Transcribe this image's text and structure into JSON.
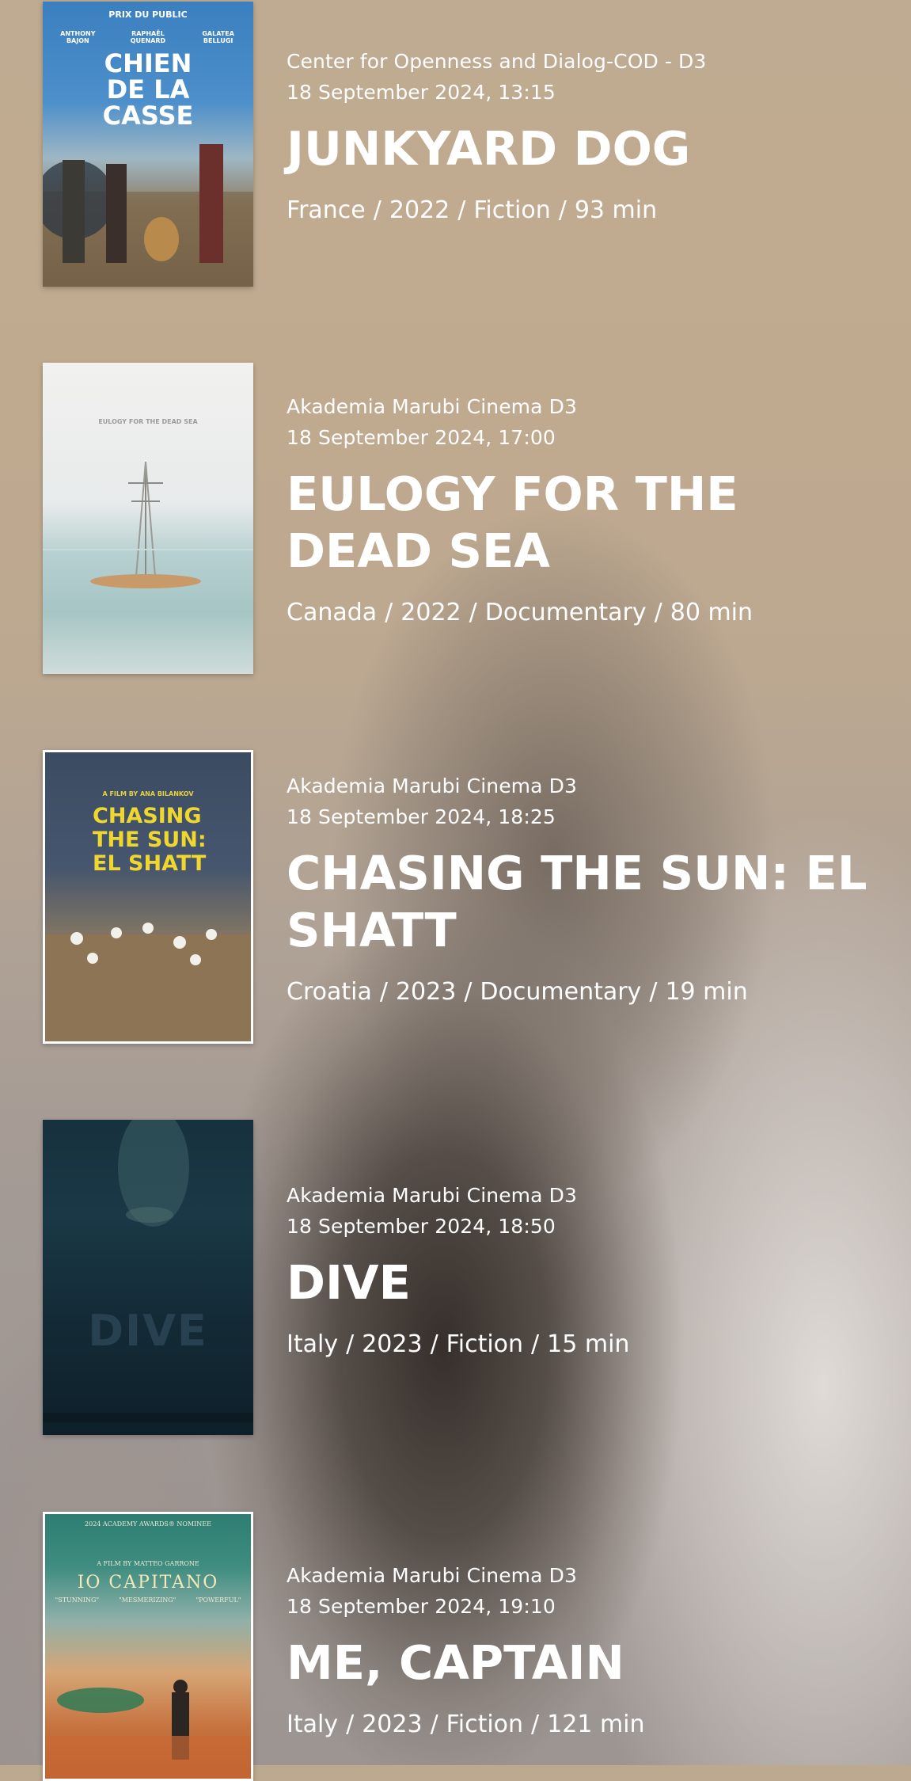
{
  "films": [
    {
      "venue": "Center for Openness and Dialog-COD - D3",
      "datetime": "18 September 2024, 13:15",
      "title": "JUNKYARD DOG",
      "country": "France",
      "year": "2022",
      "genre": "Fiction",
      "duration": "93 min",
      "poster": {
        "badge": "PRIX DU PUBLIC",
        "names": [
          "ANTHONY BAJON",
          "RAPHAËL QUENARD",
          "GALATEA BELLUGI"
        ],
        "title_lines": [
          "CHIEN",
          "DE LA",
          "CASSE"
        ]
      }
    },
    {
      "venue": "Akademia Marubi Cinema D3",
      "datetime": "18 September 2024, 17:00",
      "title": "EULOGY FOR THE DEAD SEA",
      "country": "Canada",
      "year": "2022",
      "genre": "Documentary",
      "duration": "80 min",
      "poster": {
        "title_lines": [
          "EULOGY FOR THE DEAD SEA"
        ]
      }
    },
    {
      "venue": "Akademia Marubi Cinema D3",
      "datetime": "18 September 2024, 18:25",
      "title": "CHASING THE SUN: EL SHATT",
      "country": "Croatia",
      "year": "2023",
      "genre": "Documentary",
      "duration": "19 min",
      "poster": {
        "tagline": "A FILM BY ANA BILANKOV",
        "title_lines": [
          "CHASING",
          "THE SUN:",
          "EL SHATT"
        ]
      }
    },
    {
      "venue": "Akademia Marubi Cinema D3",
      "datetime": "18 September 2024, 18:50",
      "title": "DIVE",
      "country": "Italy",
      "year": "2023",
      "genre": "Fiction",
      "duration": "15 min",
      "poster": {
        "title_lines": [
          "DIVE"
        ]
      }
    },
    {
      "venue": "Akademia Marubi Cinema D3",
      "datetime": "18 September 2024, 19:10",
      "title": "ME, CAPTAIN",
      "country": "Italy",
      "year": "2023",
      "genre": "Fiction",
      "duration": "121 min",
      "poster": {
        "top_text": "2024 ACADEMY AWARDS® NOMINEE",
        "director": "A FILM BY MATTEO GARRONE",
        "title_lines": [
          "IO CAPITANO"
        ],
        "quotes": [
          "\"STUNNING\"",
          "\"MESMERIZING\"",
          "\"POWERFUL\""
        ]
      }
    }
  ],
  "separator": "/"
}
